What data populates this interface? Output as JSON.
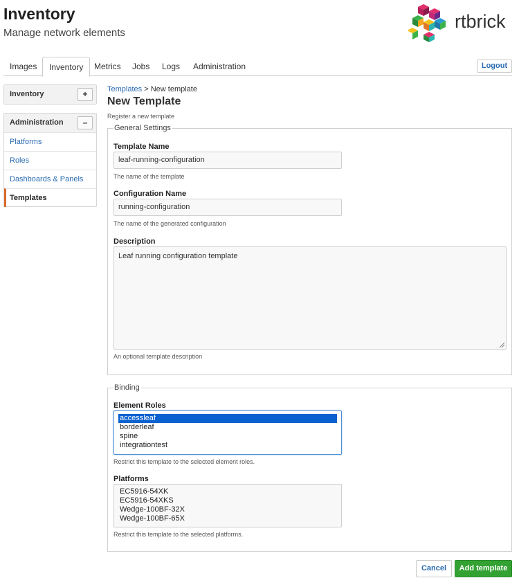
{
  "header": {
    "title": "Inventory",
    "subtitle": "Manage network elements",
    "brand": "rtbrick"
  },
  "tabs": [
    {
      "label": "Images",
      "active": false
    },
    {
      "label": "Inventory",
      "active": true
    },
    {
      "label": "Metrics",
      "active": false
    },
    {
      "label": "Jobs",
      "active": false
    },
    {
      "label": "Logs",
      "active": false
    },
    {
      "label": "Administration",
      "active": false
    }
  ],
  "logout_label": "Logout",
  "sidebar": {
    "inventory": {
      "title": "Inventory",
      "toggle": "+"
    },
    "administration": {
      "title": "Administration",
      "toggle": "–",
      "items": [
        {
          "label": "Platforms"
        },
        {
          "label": "Roles"
        },
        {
          "label": "Dashboards & Panels"
        },
        {
          "label": "Templates",
          "active": true
        }
      ]
    }
  },
  "breadcrumb": {
    "link": "Templates",
    "separator": ">",
    "current": "New template"
  },
  "form": {
    "title": "New Template",
    "description": "Register a new template",
    "general": {
      "legend": "General Settings",
      "template_name": {
        "label": "Template Name",
        "value": "leaf-running-configuration",
        "help": "The name of the template"
      },
      "config_name": {
        "label": "Configuration Name",
        "value": "running-configuration",
        "help": "The name of the generated configuration"
      },
      "description": {
        "label": "Description",
        "value": "Leaf running configuration template",
        "help": "An optional template description"
      }
    },
    "binding": {
      "legend": "Binding",
      "element_roles": {
        "label": "Element Roles",
        "options": [
          "accessleaf",
          "borderleaf",
          "spine",
          "integrationtest"
        ],
        "selected": "accessleaf",
        "help": "Restrict this template to the selected element roles."
      },
      "platforms": {
        "label": "Platforms",
        "options": [
          "EC5916-54XK",
          "EC5916-54XKS",
          "Wedge-100BF-32X",
          "Wedge-100BF-65X"
        ],
        "help": "Restrict this template to the selected platforms."
      }
    },
    "cancel_label": "Cancel",
    "submit_label": "Add template"
  },
  "colors": {
    "link": "#2a6bb1",
    "primary_button": "#33a233",
    "active_accent": "#d9692b",
    "selection": "#0a62d0"
  }
}
